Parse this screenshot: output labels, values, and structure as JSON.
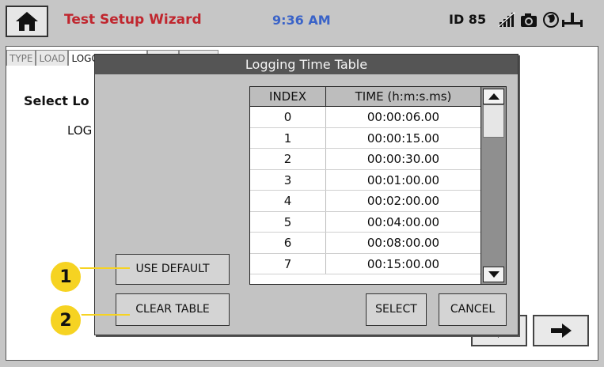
{
  "header": {
    "title": "Test Setup Wizard",
    "time": "9:36 AM",
    "id_label": "ID 85",
    "icons": [
      "home-icon",
      "no-signal-icon",
      "camera-icon",
      "network-globe-icon",
      "usb-icon"
    ]
  },
  "tabs": [
    "TYPE",
    "LOAD",
    "LOGGING",
    "",
    ""
  ],
  "background": {
    "select_label": "Select Lo",
    "logging_label": "LOG"
  },
  "dialog": {
    "title": "Logging Time Table",
    "columns": [
      "INDEX",
      "TIME (h:m:s.ms)"
    ],
    "rows": [
      {
        "index": "0",
        "time": "00:00:06.00"
      },
      {
        "index": "1",
        "time": "00:00:15.00"
      },
      {
        "index": "2",
        "time": "00:00:30.00"
      },
      {
        "index": "3",
        "time": "00:01:00.00"
      },
      {
        "index": "4",
        "time": "00:02:00.00"
      },
      {
        "index": "5",
        "time": "00:04:00.00"
      },
      {
        "index": "6",
        "time": "00:08:00.00"
      },
      {
        "index": "7",
        "time": "00:15:00.00"
      }
    ],
    "buttons": {
      "use_default": "USE DEFAULT",
      "clear_table": "CLEAR TABLE",
      "select": "SELECT",
      "cancel": "CANCEL"
    }
  },
  "callouts": [
    "1",
    "2"
  ],
  "colors": {
    "title": "#c0262e",
    "clock": "#3a63c8",
    "callout": "#f6d322",
    "dialog_title_bar": "#555555"
  }
}
